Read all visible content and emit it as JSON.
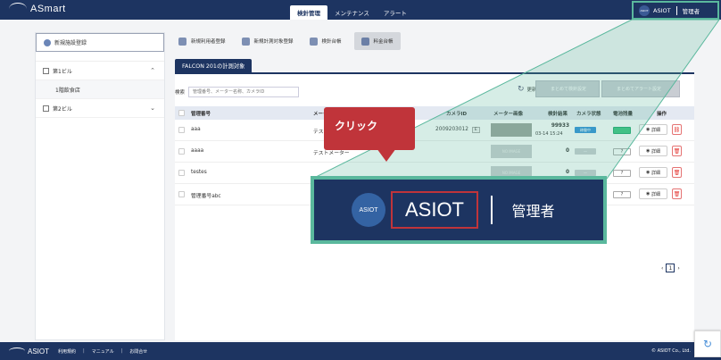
{
  "header": {
    "brand": "ASmart",
    "tabs": [
      {
        "label": "検針管理",
        "active": true
      },
      {
        "label": "メンテナンス",
        "active": false
      },
      {
        "label": "アラート",
        "active": false
      }
    ],
    "account": {
      "logo_text": "ASIOT",
      "company": "ASIOT",
      "role": "管理者"
    }
  },
  "sidebar": {
    "register_button": "新規施設登録",
    "tree": [
      {
        "label": "第1ビル",
        "expanded": true,
        "children": [
          "1階飲食店"
        ]
      },
      {
        "label": "第2ビル",
        "expanded": false,
        "children": []
      }
    ]
  },
  "main": {
    "actions": [
      {
        "label": "新規利用者登録"
      },
      {
        "label": "新規計測対象登録"
      },
      {
        "label": "検針台帳"
      },
      {
        "label": "料金台帳"
      }
    ],
    "subtab": "FALCON 201の計測対象",
    "search": {
      "label": "検索",
      "placeholder": "管理番号、メーター名称、カメラID"
    },
    "refresh_label": "更新",
    "bulk_meter_button": "まとめて検針設定",
    "bulk_alert_button": "まとめてアラート設定",
    "columns": [
      "管理番号",
      "メーター",
      "カメラID",
      "メーター画像",
      "検針結果",
      "カメラ状態",
      "電池残量",
      "操作"
    ],
    "rows": [
      {
        "id": "aaa",
        "meter": "テストメーター",
        "camera_id": "2009203012",
        "camera_badge": "E",
        "image": "meter",
        "result_value": "99933",
        "result_time": "03-14 15:24",
        "camera_state": "稼働中",
        "battery": "full",
        "detail": "詳細"
      },
      {
        "id": "aaaa",
        "meter": "テストメーター",
        "camera_id": "",
        "camera_badge": "",
        "image": "NO IMAGE",
        "result_value": "0",
        "result_time": "",
        "camera_state": "—",
        "battery": "?",
        "detail": "詳細"
      },
      {
        "id": "testes",
        "meter": "",
        "camera_id": "",
        "camera_badge": "",
        "image": "NO IMAGE",
        "result_value": "0",
        "result_time": "",
        "camera_state": "—",
        "battery": "?",
        "detail": "詳細"
      },
      {
        "id": "管理番号abc",
        "meter": "",
        "camera_id": "",
        "camera_badge": "",
        "image": "NO IMAGE",
        "result_value": "0",
        "result_time": "",
        "camera_state": "—",
        "battery": "?",
        "detail": "詳細"
      }
    ],
    "pagination": {
      "current": "1"
    }
  },
  "callout": {
    "text": "クリック"
  },
  "zoom": {
    "logo_text": "ASIOT",
    "company": "ASIOT",
    "role": "管理者"
  },
  "footer": {
    "brand": "ASIOT",
    "links": [
      "利用規約",
      "マニュアル",
      "お問合せ"
    ],
    "copyright": "© ASIOT Co., Ltd."
  },
  "colors": {
    "navy": "#1d3461",
    "accent_green": "#5ab89d",
    "callout_red": "#c0343a",
    "status_blue": "#2e8fd8"
  }
}
